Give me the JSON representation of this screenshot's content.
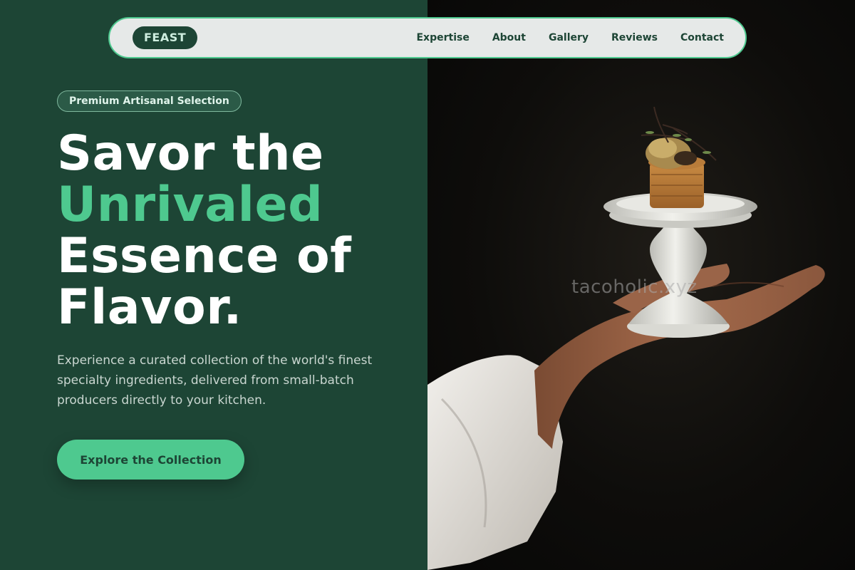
{
  "nav": {
    "logo": "FEAST",
    "links": [
      "Expertise",
      "About",
      "Gallery",
      "Reviews",
      "Contact"
    ]
  },
  "hero": {
    "badge": "Premium Artisanal Selection",
    "headline": {
      "line1": "Savor the",
      "line2": "Unrivaled",
      "line3": "Essence of",
      "line4": "Flavor."
    },
    "subtext": "Experience a curated collection of the world's finest specialty ingredients, delivered from small-batch producers directly to your kitchen.",
    "cta_label": "Explore the Collection"
  },
  "image": {
    "watermark": "tacoholic.xyz"
  },
  "colors": {
    "panel_bg": "#1d4535",
    "accent": "#4ec98f",
    "nav_bg": "#e6e9e8"
  }
}
